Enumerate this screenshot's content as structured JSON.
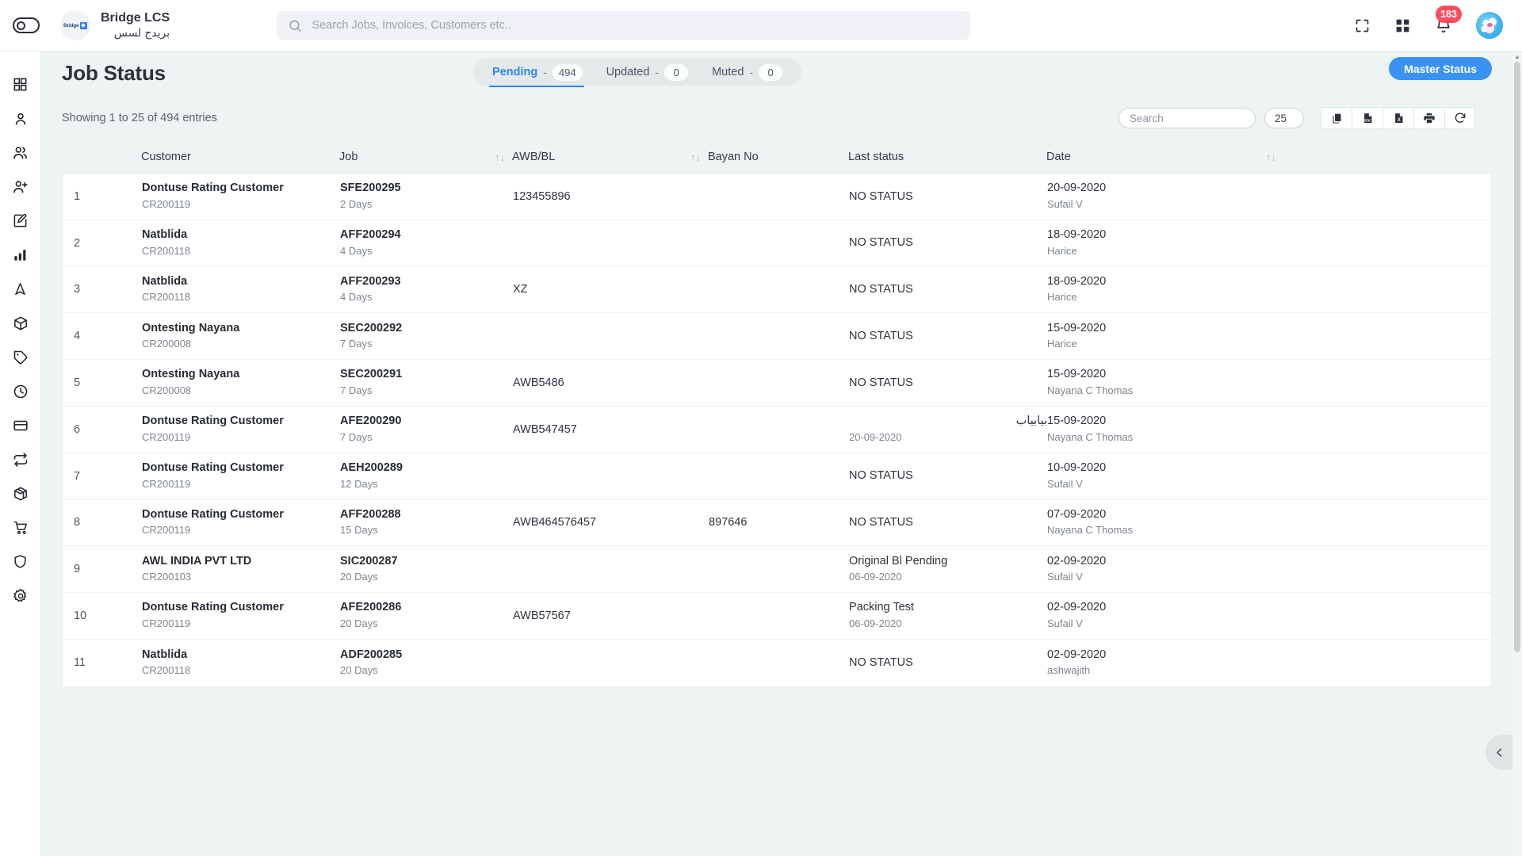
{
  "header": {
    "brand_en": "Bridge LCS",
    "brand_ar": "بريدج لسس",
    "brand_logo_text": "Bridge",
    "search_placeholder": "Search Jobs, Invoices, Customers etc..",
    "search_value": "",
    "notification_count": "183",
    "icons": [
      "sidebar-toggle-icon",
      "search-icon",
      "fullscreen-icon",
      "apps-grid-icon",
      "notification-bell-icon",
      "avatar"
    ]
  },
  "sidebar": {
    "items": [
      {
        "name": "dashboard",
        "icon": "grid-icon"
      },
      {
        "name": "profile",
        "icon": "user-icon"
      },
      {
        "name": "customers",
        "icon": "users-icon"
      },
      {
        "name": "add-user",
        "icon": "user-plus-icon"
      },
      {
        "name": "jobs",
        "icon": "edit-square-icon"
      },
      {
        "name": "reports",
        "icon": "bar-chart-icon"
      },
      {
        "name": "tracking",
        "icon": "navigation-icon"
      },
      {
        "name": "packages",
        "icon": "box-icon"
      },
      {
        "name": "tags",
        "icon": "tag-icon"
      },
      {
        "name": "history",
        "icon": "clock-icon"
      },
      {
        "name": "payments",
        "icon": "credit-card-icon"
      },
      {
        "name": "transfers",
        "icon": "repeat-icon"
      },
      {
        "name": "inventory",
        "icon": "cube-icon"
      },
      {
        "name": "purchase",
        "icon": "shopping-cart-icon"
      },
      {
        "name": "security",
        "icon": "shield-icon"
      },
      {
        "name": "settings",
        "icon": "gear-icon"
      }
    ]
  },
  "page": {
    "title": "Job Status",
    "master_status_label": "Master Status",
    "tabs": [
      {
        "label": "Pending",
        "dash": "-",
        "count": "494",
        "active": true
      },
      {
        "label": "Updated",
        "dash": "-",
        "count": "0",
        "active": false
      },
      {
        "label": "Muted",
        "dash": "-",
        "count": "0",
        "active": false
      }
    ]
  },
  "toolbar": {
    "showing_text": "Showing 1 to 25 of 494 entries",
    "search_placeholder": "Search",
    "search_value": "",
    "page_size": "25",
    "buttons": [
      {
        "name": "copy-button",
        "icon": "copy-icon"
      },
      {
        "name": "pdf-export-button",
        "icon": "file-pdf-icon"
      },
      {
        "name": "excel-export-button",
        "icon": "file-excel-icon"
      },
      {
        "name": "print-button",
        "icon": "printer-icon"
      },
      {
        "name": "refresh-button",
        "icon": "refresh-icon"
      }
    ]
  },
  "table": {
    "columns": [
      "",
      "Customer",
      "Job",
      "AWB/BL",
      "Bayan No",
      "Last status",
      "Date"
    ],
    "headers": {
      "customer": "Customer",
      "job": "Job",
      "awb": "AWB/BL",
      "bayan": "Bayan No",
      "status": "Last status",
      "date": "Date"
    },
    "sort_icon": "↑↓",
    "rows": [
      {
        "idx": "1",
        "customer": "Dontuse Rating Customer",
        "customer_code": "CR200119",
        "job": "SFE200295",
        "job_days": "2 Days",
        "awb": "123455896",
        "bayan": "",
        "status": "NO STATUS",
        "status_date": "",
        "date": "20-09-2020",
        "user": "Sufail V"
      },
      {
        "idx": "2",
        "customer": "Natblida",
        "customer_code": "CR200118",
        "job": "AFF200294",
        "job_days": "4 Days",
        "awb": "",
        "bayan": "",
        "status": "NO STATUS",
        "status_date": "",
        "date": "18-09-2020",
        "user": "Harice"
      },
      {
        "idx": "3",
        "customer": "Natblida",
        "customer_code": "CR200118",
        "job": "AFF200293",
        "job_days": "4 Days",
        "awb": "XZ",
        "bayan": "",
        "status": "NO STATUS",
        "status_date": "",
        "date": "18-09-2020",
        "user": "Harice"
      },
      {
        "idx": "4",
        "customer": "Ontesting Nayana",
        "customer_code": "CR200008",
        "job": "SEC200292",
        "job_days": "7 Days",
        "awb": "",
        "bayan": "",
        "status": "NO STATUS",
        "status_date": "",
        "date": "15-09-2020",
        "user": "Harice"
      },
      {
        "idx": "5",
        "customer": "Ontesting Nayana",
        "customer_code": "CR200008",
        "job": "SEC200291",
        "job_days": "7 Days",
        "awb": "AWB5486",
        "bayan": "",
        "status": "NO STATUS",
        "status_date": "",
        "date": "15-09-2020",
        "user": "Nayana C Thomas"
      },
      {
        "idx": "6",
        "customer": "Dontuse Rating Customer",
        "customer_code": "CR200119",
        "job": "AFE200290",
        "job_days": "7 Days",
        "awb": "AWB547457",
        "bayan": "",
        "status": "بيابياب",
        "status_date": "20-09-2020",
        "date": "15-09-2020",
        "user": "Nayana C Thomas"
      },
      {
        "idx": "7",
        "customer": "Dontuse Rating Customer",
        "customer_code": "CR200119",
        "job": "AEH200289",
        "job_days": "12 Days",
        "awb": "",
        "bayan": "",
        "status": "NO STATUS",
        "status_date": "",
        "date": "10-09-2020",
        "user": "Sufail V"
      },
      {
        "idx": "8",
        "customer": "Dontuse Rating Customer",
        "customer_code": "CR200119",
        "job": "AFF200288",
        "job_days": "15 Days",
        "awb": "AWB464576457",
        "bayan": "897646",
        "status": "NO STATUS",
        "status_date": "",
        "date": "07-09-2020",
        "user": "Nayana C Thomas"
      },
      {
        "idx": "9",
        "customer": "AWL INDIA PVT LTD",
        "customer_code": "CR200103",
        "job": "SIC200287",
        "job_days": "20 Days",
        "awb": "",
        "bayan": "",
        "status": "Original Bl Pending",
        "status_date": "06-09-2020",
        "date": "02-09-2020",
        "user": "Sufail V"
      },
      {
        "idx": "10",
        "customer": "Dontuse Rating Customer",
        "customer_code": "CR200119",
        "job": "AFE200286",
        "job_days": "20 Days",
        "awb": "AWB57567",
        "bayan": "",
        "status": "Packing Test",
        "status_date": "06-09-2020",
        "date": "02-09-2020",
        "user": "Sufail V"
      },
      {
        "idx": "11",
        "customer": "Natblida",
        "customer_code": "CR200118",
        "job": "ADF200285",
        "job_days": "20 Days",
        "awb": "",
        "bayan": "",
        "status": "NO STATUS",
        "status_date": "",
        "date": "02-09-2020",
        "user": "ashwajith"
      }
    ]
  },
  "colors": {
    "accent": "#3a93f2",
    "badge": "#fb4d5c",
    "page_bg": "#eef3f3",
    "tab_pill_bg": "#e4eaea"
  },
  "right_panel": {
    "toggle_icon": "chevron-left-icon"
  }
}
